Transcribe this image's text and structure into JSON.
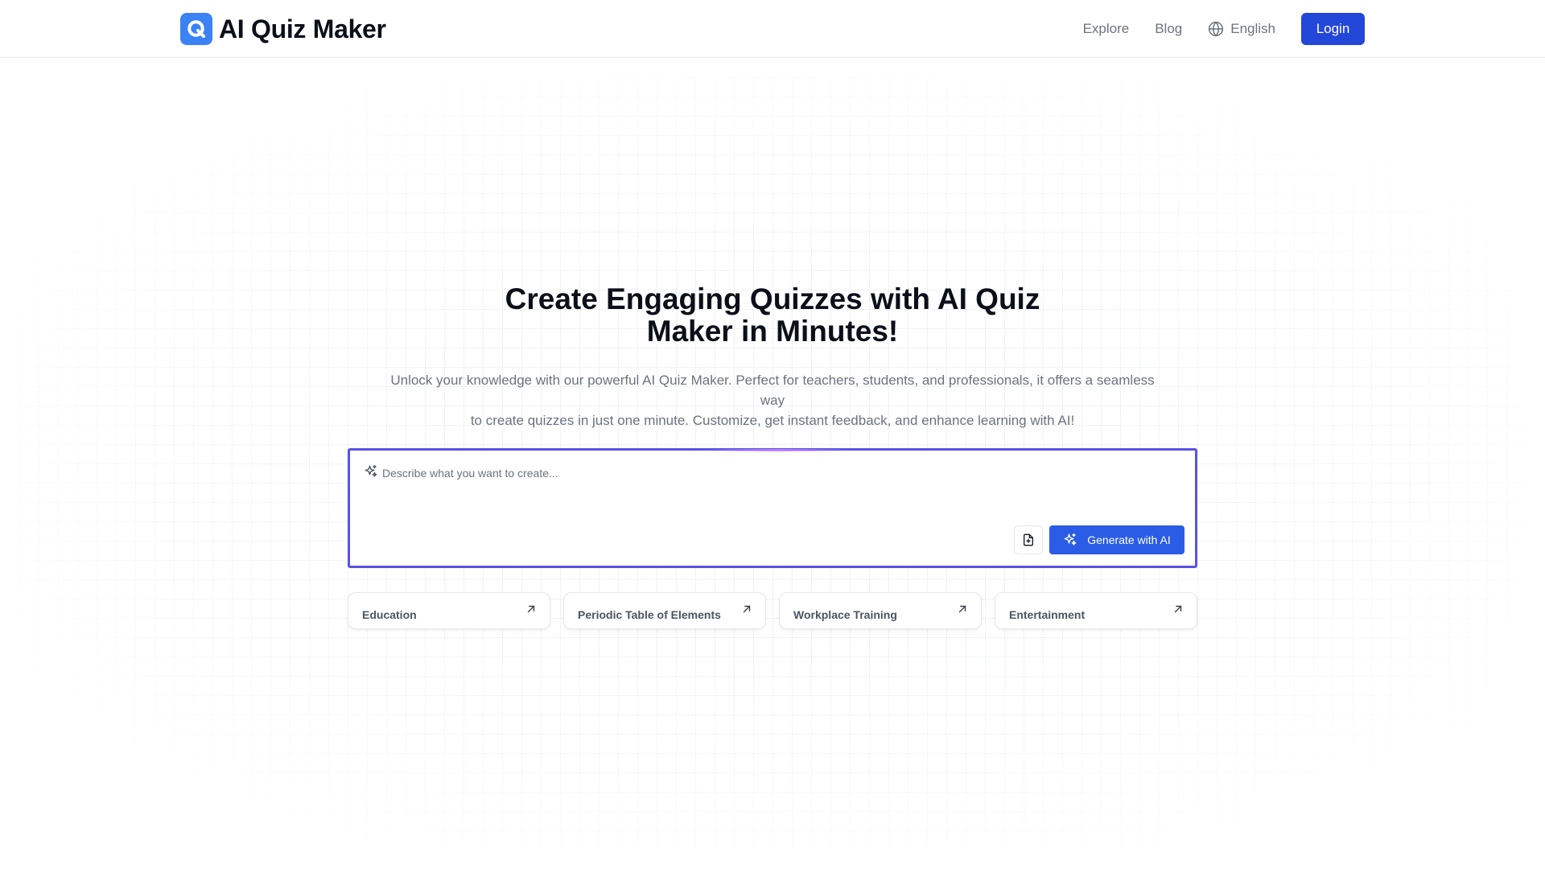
{
  "header": {
    "brand": "AI Quiz Maker",
    "nav": [
      "Explore",
      "Blog"
    ],
    "language": "English",
    "login_label": "Login"
  },
  "hero": {
    "title_line1": "Create Engaging Quizzes with AI Quiz",
    "title_line2": "Maker in Minutes!",
    "subtitle_line1": "Unlock your knowledge with our powerful AI Quiz Maker. Perfect for teachers, students, and professionals, it offers a seamless way",
    "subtitle_line2": "to create quizzes in just one minute. Customize, get instant feedback, and enhance learning with AI!"
  },
  "prompt": {
    "placeholder": "Describe what you want to create...",
    "value": "",
    "generate_label": "Generate with AI"
  },
  "categories": [
    "Education",
    "Periodic Table of Elements",
    "Workplace Training",
    "Entertainment"
  ],
  "colors": {
    "primary": "#2347d8",
    "generate": "#2a5ce6",
    "prompt_border": "#5b52e6",
    "logo": "#3b82f6"
  },
  "icons": {
    "logo": "q-logo-icon",
    "language": "globe-icon",
    "prompt": "sparkle-icon",
    "upload": "file-plus-icon",
    "category": "arrow-up-right-icon"
  }
}
